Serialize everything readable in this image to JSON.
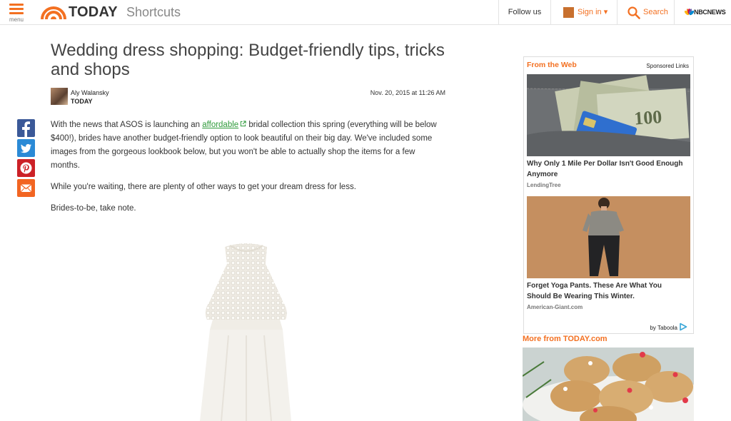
{
  "header": {
    "menu_label": "menu",
    "brand": "TODAY",
    "section": "Shortcuts",
    "follow_label": "Follow us",
    "signin_label": "Sign in ▾",
    "search_label": "Search",
    "network_label": "NBCNEWS"
  },
  "article": {
    "title": "Wedding dress shopping: Budget-friendly tips, tricks and shops",
    "author": "Aly Walansky",
    "outlet": "TODAY",
    "date": "Nov. 20, 2015 at 11:26 AM",
    "p1_before": "With the news that ASOS is launching an ",
    "p1_link": "affordable",
    "p1_after": " bridal collection this spring (everything will be below $400!), brides have another budget-friendly option to look beautiful on their big day. We've included some images from the gorgeous lookbook below, but you won't be able to actually shop the items for a few months.",
    "p2": "While you're waiting, there are plenty of other ways to get your dream dress for less.",
    "p3": "Brides-to-be, take note."
  },
  "share": [
    "facebook-icon",
    "twitter-icon",
    "pinterest-icon",
    "email-icon"
  ],
  "sidebar": {
    "ad_heading": "From the Web",
    "sponsored": "Sponsored Links",
    "items": [
      {
        "title": "Why Only 1 Mile Per Dollar Isn't Good Enough Anymore",
        "source": "LendingTree"
      },
      {
        "title": "Forget Yoga Pants. These Are What You Should Be Wearing This Winter.",
        "source": "American-Giant.com"
      }
    ],
    "provider": "by Taboola",
    "more_heading": "More from TODAY.com"
  },
  "colors": {
    "accent": "#f37021",
    "link": "#2e9a3a",
    "facebook": "#3b5998",
    "twitter": "#2b8ad6",
    "pinterest": "#cc2127",
    "email": "#f26522"
  }
}
